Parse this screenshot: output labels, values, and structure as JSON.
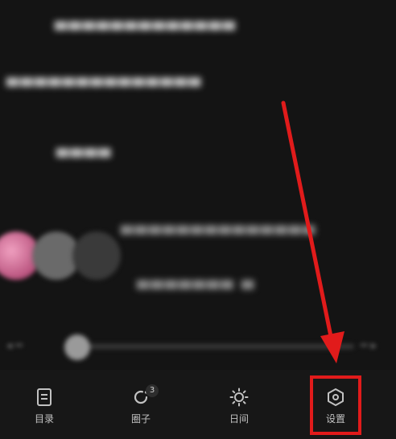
{
  "toolbar": {
    "items": [
      {
        "label": "目录",
        "icon": "contents-icon"
      },
      {
        "label": "圈子",
        "icon": "circle-refresh-icon",
        "badge": "3"
      },
      {
        "label": "日间",
        "icon": "sun-icon"
      },
      {
        "label": "设置",
        "icon": "settings-hexagon-icon"
      }
    ]
  },
  "colors": {
    "background": "#151515",
    "highlight": "#e11b1b",
    "icon": "#c2c2c2"
  }
}
